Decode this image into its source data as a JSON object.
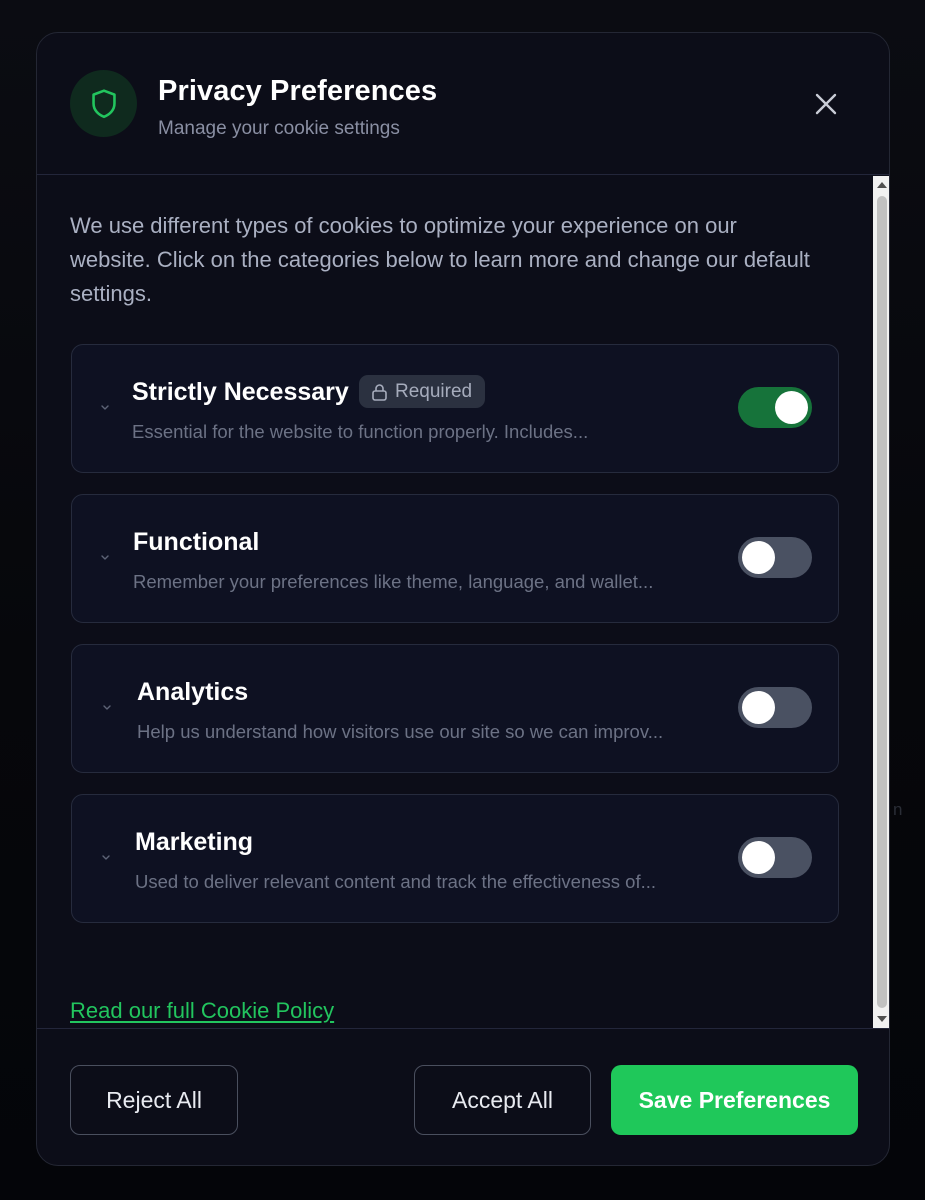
{
  "background": {
    "partial_text": "n"
  },
  "header": {
    "title": "Privacy Preferences",
    "subtitle": "Manage your cookie settings",
    "icon": "shield-icon",
    "close_icon": "close-icon"
  },
  "intro": "We use different types of cookies to optimize your experience on our website. Click on the categories below to learn more and change our default settings.",
  "categories": [
    {
      "title": "Strictly Necessary",
      "badge": "Required",
      "badge_icon": "lock-icon",
      "description": "Essential for the website to function properly. Includes...",
      "enabled": true,
      "locked": true
    },
    {
      "title": "Functional",
      "description": "Remember your preferences like theme, language, and wallet...",
      "enabled": false
    },
    {
      "title": "Analytics",
      "description": "Help us understand how visitors use our site so we can improv...",
      "enabled": false
    },
    {
      "title": "Marketing",
      "description": "Used to deliver relevant content and track the effectiveness of...",
      "enabled": false
    }
  ],
  "policy_link": "Read our full Cookie Policy",
  "footer": {
    "reject_label": "Reject All",
    "accept_label": "Accept All",
    "save_label": "Save Preferences"
  },
  "colors": {
    "accent": "#1fc85a",
    "toggle_on": "#16733a",
    "toggle_off": "#4a5162",
    "link": "#22c55e",
    "surface": "#0c0d18"
  }
}
